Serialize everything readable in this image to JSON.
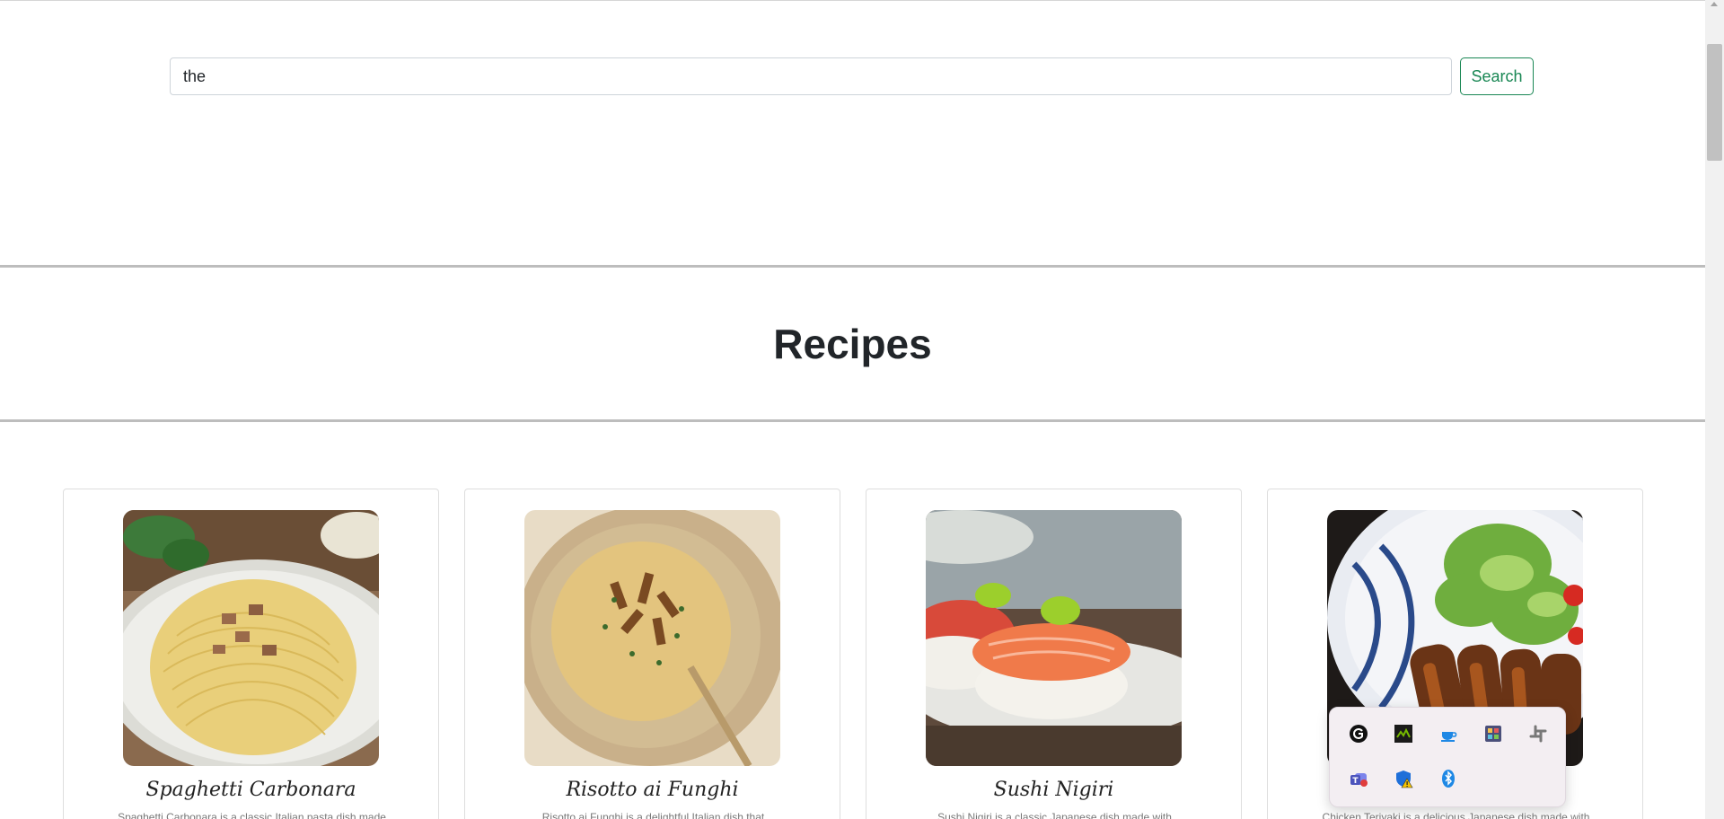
{
  "search": {
    "value": "the",
    "button_label": "Search"
  },
  "page_title": "Recipes",
  "recipes": [
    {
      "name": "Spaghetti Carbonara",
      "desc": "Spaghetti Carbonara is a classic Italian pasta dish made"
    },
    {
      "name": "Risotto ai Funghi",
      "desc": "Risotto ai Funghi is a delightful Italian dish that"
    },
    {
      "name": "Sushi Nigiri",
      "desc": "Sushi Nigiri is a classic Japanese dish made with"
    },
    {
      "name": "",
      "desc": "Chicken Teriyaki is a delicious Japanese dish made with"
    }
  ],
  "tray": {
    "icons": [
      "logitech-g-hub-icon",
      "nvidia-icon",
      "coffee-cup-icon",
      "color-palette-icon",
      "slack-icon",
      "teams-icon",
      "windows-security-warning-icon",
      "bluetooth-icon"
    ]
  },
  "colors": {
    "accent": "#198754",
    "divider": "#bdbdbd"
  }
}
